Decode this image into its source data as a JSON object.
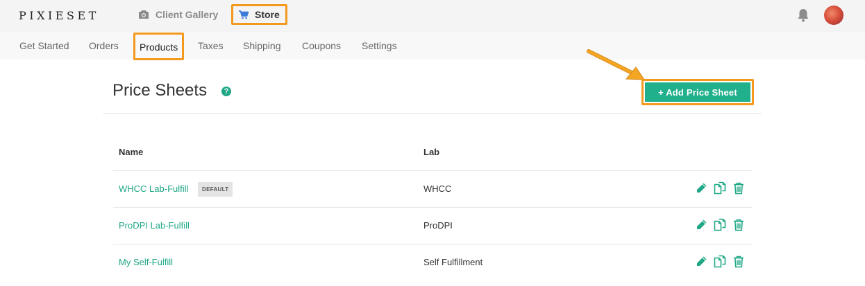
{
  "brand": {
    "logo_text": "PIXIESET"
  },
  "top_nav": {
    "client_gallery_label": "Client Gallery",
    "store_label": "Store"
  },
  "sub_nav": {
    "items": [
      "Get Started",
      "Orders",
      "Products",
      "Taxes",
      "Shipping",
      "Coupons",
      "Settings"
    ]
  },
  "page": {
    "title": "Price Sheets",
    "help_glyph": "?",
    "add_button_label": "+ Add Price Sheet"
  },
  "table": {
    "headers": {
      "name": "Name",
      "lab": "Lab"
    },
    "rows": [
      {
        "name": "WHCC Lab-Fulfill",
        "badge": "DEFAULT",
        "lab": "WHCC"
      },
      {
        "name": "ProDPI Lab-Fulfill",
        "lab": "ProDPI"
      },
      {
        "name": "My Self-Fulfill",
        "lab": "Self Fulfillment"
      }
    ]
  },
  "colors": {
    "accent": "#21b08c",
    "highlight": "#f39a1e",
    "topbar_bg": "#f4f4f5"
  },
  "icons": [
    "camera-icon",
    "cart-icon",
    "bell-icon",
    "help-icon",
    "pencil-icon",
    "copy-icon",
    "trash-icon",
    "arrow-icon"
  ]
}
